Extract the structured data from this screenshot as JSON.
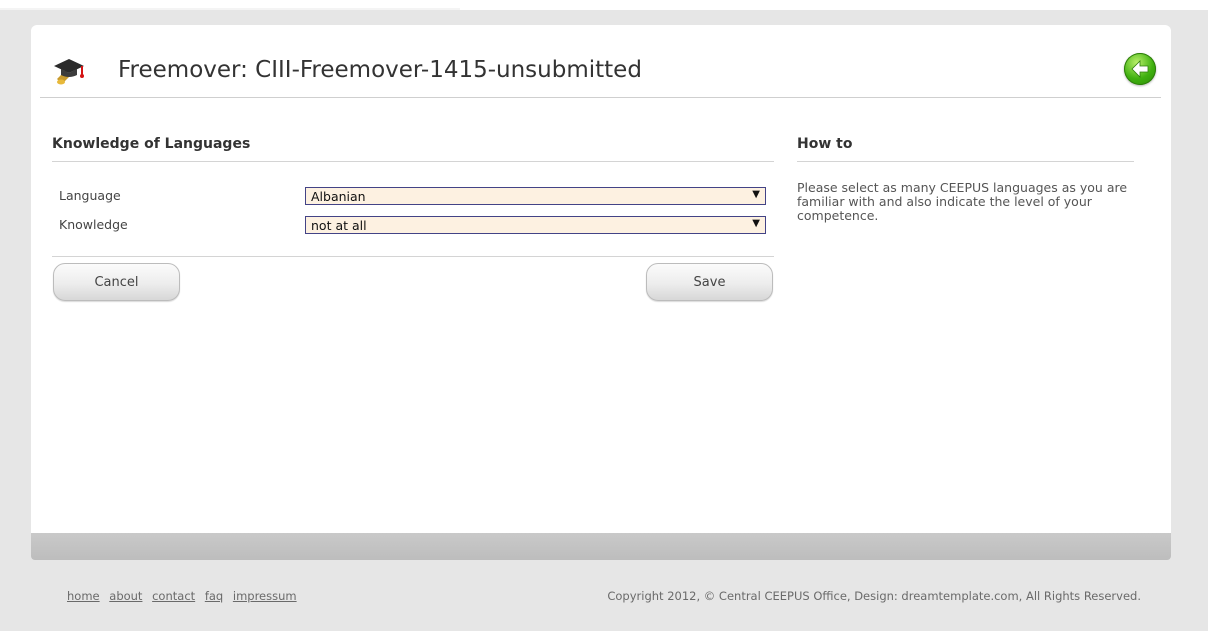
{
  "header": {
    "title": "Freemover: CIII-Freemover-1415-unsubmitted",
    "icon": "graduation-cap-icon",
    "back_icon": "back-arrow-icon"
  },
  "form": {
    "section_title": "Knowledge of Languages",
    "fields": [
      {
        "label": "Language",
        "value": "Albanian"
      },
      {
        "label": "Knowledge",
        "value": "not at all"
      }
    ],
    "cancel_label": "Cancel",
    "save_label": "Save"
  },
  "help": {
    "title": "How to",
    "text": "Please select as many CEEPUS languages as you are familiar with and also indicate the level of your competence."
  },
  "footer": {
    "links": [
      "home",
      "about",
      "contact",
      "faq",
      "impressum"
    ],
    "copyright": "Copyright 2012, © Central CEEPUS Office, Design: dreamtemplate.com, All Rights Reserved."
  },
  "colors": {
    "page_background": "#e6e6e6",
    "select_background": "#fdf1e1",
    "select_border": "#434386",
    "back_button": "#3fb00f"
  }
}
